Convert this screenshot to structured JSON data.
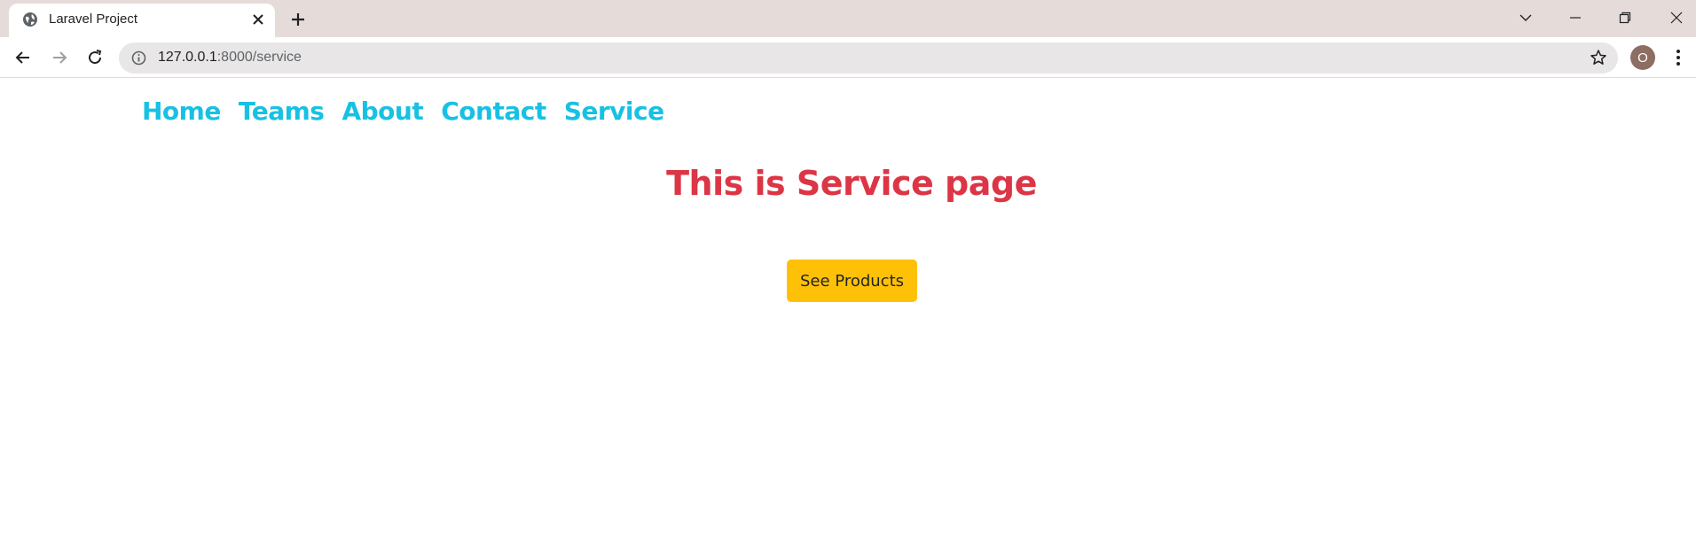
{
  "browser": {
    "tab": {
      "title": "Laravel Project"
    },
    "address": {
      "host": "127.0.0.1",
      "path": ":8000/service"
    },
    "profile_initial": "O"
  },
  "nav": {
    "items": [
      {
        "label": "Home"
      },
      {
        "label": "Teams"
      },
      {
        "label": "About"
      },
      {
        "label": "Contact"
      },
      {
        "label": "Service"
      }
    ],
    "color": "#17c1e3"
  },
  "main": {
    "heading": "This is Service page",
    "heading_color": "#dc3545",
    "button_label": "See Products",
    "button_color": "#ffc107"
  }
}
